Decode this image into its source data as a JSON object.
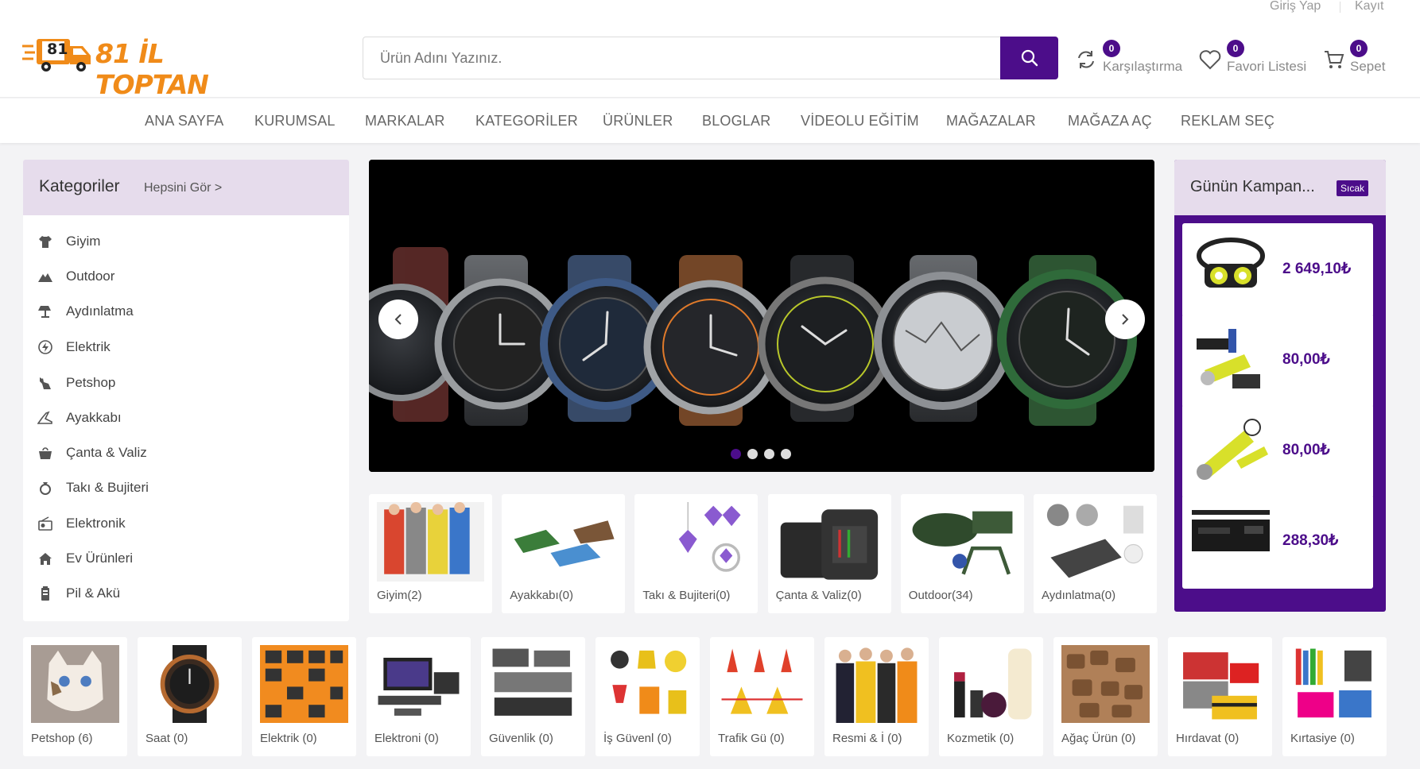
{
  "topbar": {
    "login": "Giriş Yap",
    "register": "Kayıt"
  },
  "header": {
    "logo_text": "81 İL TOPTAN",
    "logo_badge": "81",
    "search_placeholder": "Ürün Adını Yazınız.",
    "compare": {
      "count": "0",
      "label": "Karşılaştırma"
    },
    "favorites": {
      "count": "0",
      "label": "Favori Listesi"
    },
    "cart": {
      "count": "0",
      "label": "Sepet"
    }
  },
  "nav": [
    "ANA SAYFA",
    "KURUMSAL",
    "MARKALAR",
    "KATEGORİLER",
    "ÜRÜNLER",
    "BLOGLAR",
    "VİDEOLU EĞİTİM",
    "MAĞAZALAR",
    "MAĞAZA AÇ",
    "REKLAM SEÇ"
  ],
  "categories": {
    "title": "Kategoriler",
    "see_all": "Hepsini Gör >",
    "items": [
      {
        "label": "Giyim",
        "icon": "shirt-icon"
      },
      {
        "label": "Outdoor",
        "icon": "mountain-icon"
      },
      {
        "label": "Aydınlatma",
        "icon": "lamp-icon"
      },
      {
        "label": "Elektrik",
        "icon": "bolt-icon"
      },
      {
        "label": "Petshop",
        "icon": "cat-icon"
      },
      {
        "label": "Ayakkabı",
        "icon": "shoe-icon"
      },
      {
        "label": "Çanta & Valiz",
        "icon": "bag-icon"
      },
      {
        "label": "Takı & Bujiteri",
        "icon": "ring-icon"
      },
      {
        "label": "Elektronik",
        "icon": "radio-icon"
      },
      {
        "label": "Ev Ürünleri",
        "icon": "home-icon"
      },
      {
        "label": "Pil & Akü",
        "icon": "battery-icon"
      }
    ]
  },
  "slider": {
    "slides": 4,
    "active": 0
  },
  "campaign": {
    "title": "Günün Kampan...",
    "badge": "Sıcak",
    "items": [
      {
        "price": "2 649,10₺"
      },
      {
        "price": "80,00₺"
      },
      {
        "price": "80,00₺"
      },
      {
        "price": "288,30₺"
      }
    ]
  },
  "mid_tiles": [
    "Giyim(2)",
    "Ayakkabı(0)",
    "Takı & Bujiteri(0)",
    "Çanta & Valiz(0)",
    "Outdoor(34)",
    "Aydınlatma(0)"
  ],
  "bottom_tiles": [
    "Petshop (6)",
    "Saat (0)",
    "Elektrik (0)",
    "Elektroni (0)",
    "Güvenlik (0)",
    "İş Güvenl (0)",
    "Trafik Gü (0)",
    "Resmi & İ (0)",
    "Kozmetik (0)",
    "Ağaç Ürün (0)",
    "Hırdavat (0)",
    "Kırtasiye (0)"
  ],
  "colors": {
    "primary": "#4c0d8a",
    "logo": "#f08b19",
    "panel_head": "#e6dcec"
  }
}
